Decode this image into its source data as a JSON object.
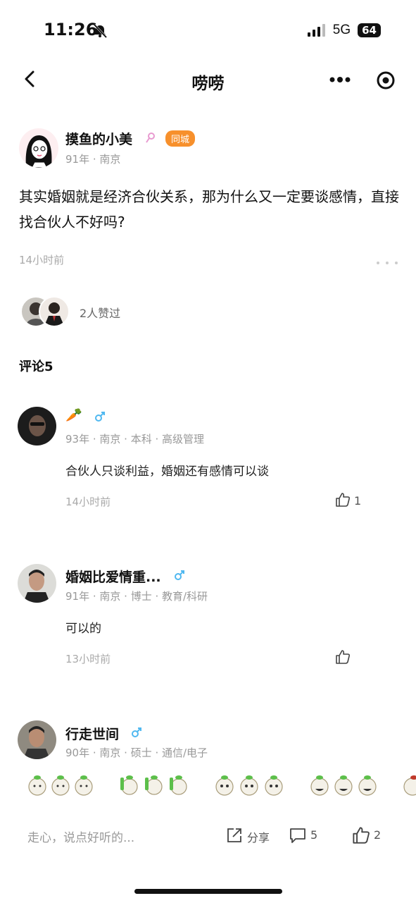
{
  "status_bar": {
    "time": "11:26",
    "network": "5G",
    "battery": "64"
  },
  "nav": {
    "title": "唠唠"
  },
  "post": {
    "author": "摸鱼的小美",
    "city_badge": "同城",
    "meta": "91年 · 南京",
    "text": "其实婚姻就是经济合伙关系，那为什么又一定要谈感情，直接找合伙人不好吗?",
    "time": "14小时前",
    "likes_text": "2人赞过"
  },
  "comments_header": "评论5",
  "comments": [
    {
      "name": "🥕",
      "meta": "93年 · 南京 · 本科 · 高级管理",
      "text": "合伙人只谈利益，婚姻还有感情可以谈",
      "time": "14小时前",
      "likes": "1"
    },
    {
      "name": "婚姻比爱情重...",
      "meta": "91年 · 南京 · 博士 · 教育/科研",
      "text": "可以的",
      "time": "13小时前",
      "likes": ""
    },
    {
      "name": "行走世间",
      "meta": "90年 · 南京 · 硕士 · 通信/电子",
      "text": "",
      "time": "",
      "likes": ""
    }
  ],
  "bottom": {
    "placeholder": "走心，说点好听的...",
    "share_label": "分享",
    "comment_count": "5",
    "like_count": "2"
  },
  "colors": {
    "badge": "#f7902c",
    "male": "#4fb8f0",
    "female": "#e89ad0"
  }
}
